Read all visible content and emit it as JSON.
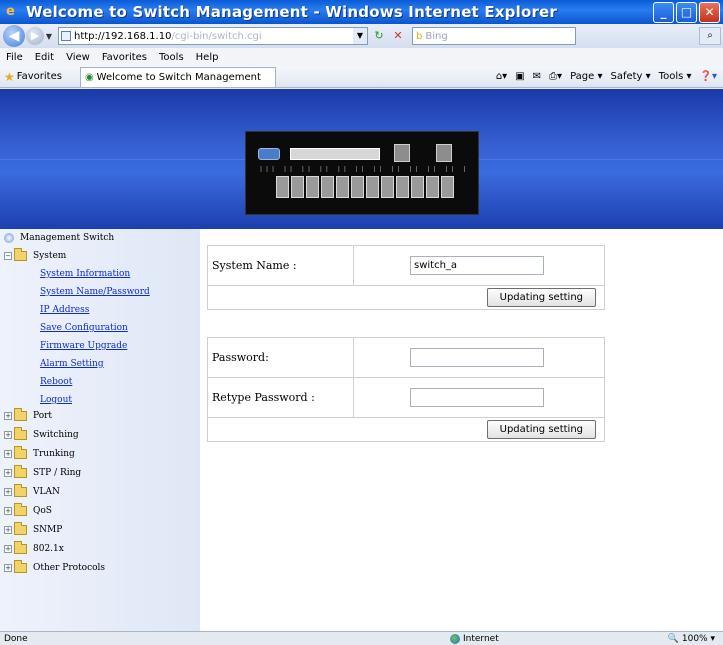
{
  "window": {
    "title": "Welcome to Switch Management - Windows Internet Explorer"
  },
  "address": {
    "url_host": "http://192.168.1.10",
    "url_path": "/cgi-bin/switch.cgi",
    "search_placeholder": "Bing"
  },
  "menu": [
    "File",
    "Edit",
    "View",
    "Favorites",
    "Tools",
    "Help"
  ],
  "favorites": {
    "label": "Favorites",
    "tab_title": "Welcome to Switch Management",
    "commands": [
      "Page ▾",
      "Safety ▾",
      "Tools ▾"
    ]
  },
  "sidebar": {
    "root": "Management Switch",
    "system_folder": "System",
    "system_items": [
      "System Information",
      "System Name/Password",
      "IP Address",
      "Save Configuration",
      "Firmware Upgrade",
      "Alarm Setting",
      "Reboot",
      "Logout"
    ],
    "folders": [
      "Port",
      "Switching",
      "Trunking",
      "STP / Ring",
      "VLAN",
      "QoS",
      "SNMP",
      "802.1x",
      "Other Protocols"
    ]
  },
  "form_system": {
    "label": "System Name :",
    "value": "switch_a",
    "button": "Updating setting"
  },
  "form_password": {
    "password_label": "Password:",
    "retype_label": "Retype Password :",
    "button": "Updating setting"
  },
  "status": {
    "left": "Done",
    "zone": "Internet",
    "zoom": "100%"
  }
}
